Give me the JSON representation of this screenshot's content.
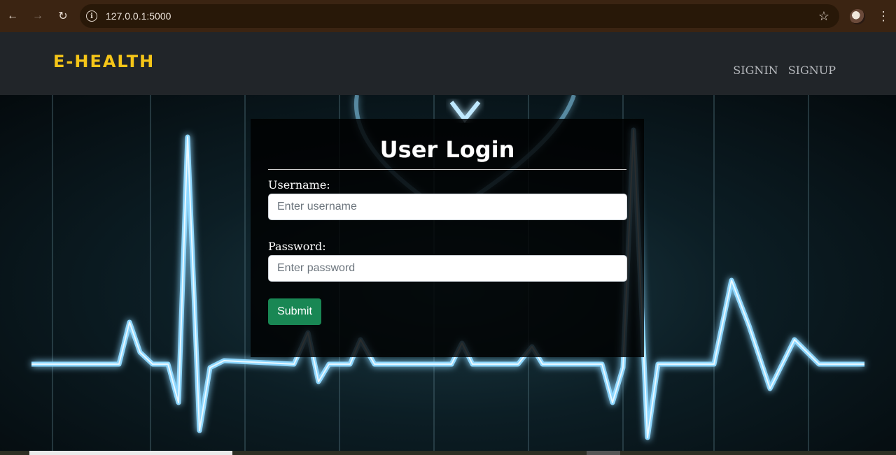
{
  "browser": {
    "url": "127.0.0.1:5000"
  },
  "header": {
    "brand": "E-HEALTH",
    "nav": [
      "SIGNIN",
      "SIGNUP"
    ]
  },
  "login": {
    "title": "User Login",
    "username_label": "Username:",
    "username_placeholder": "Enter username",
    "password_label": "Password:",
    "password_placeholder": "Enter password",
    "submit_label": "Submit"
  },
  "colors": {
    "brand": "#f5c518",
    "header_bg": "#212529",
    "submit_bg": "#198754",
    "ecg_line": "#8fd8ff"
  }
}
